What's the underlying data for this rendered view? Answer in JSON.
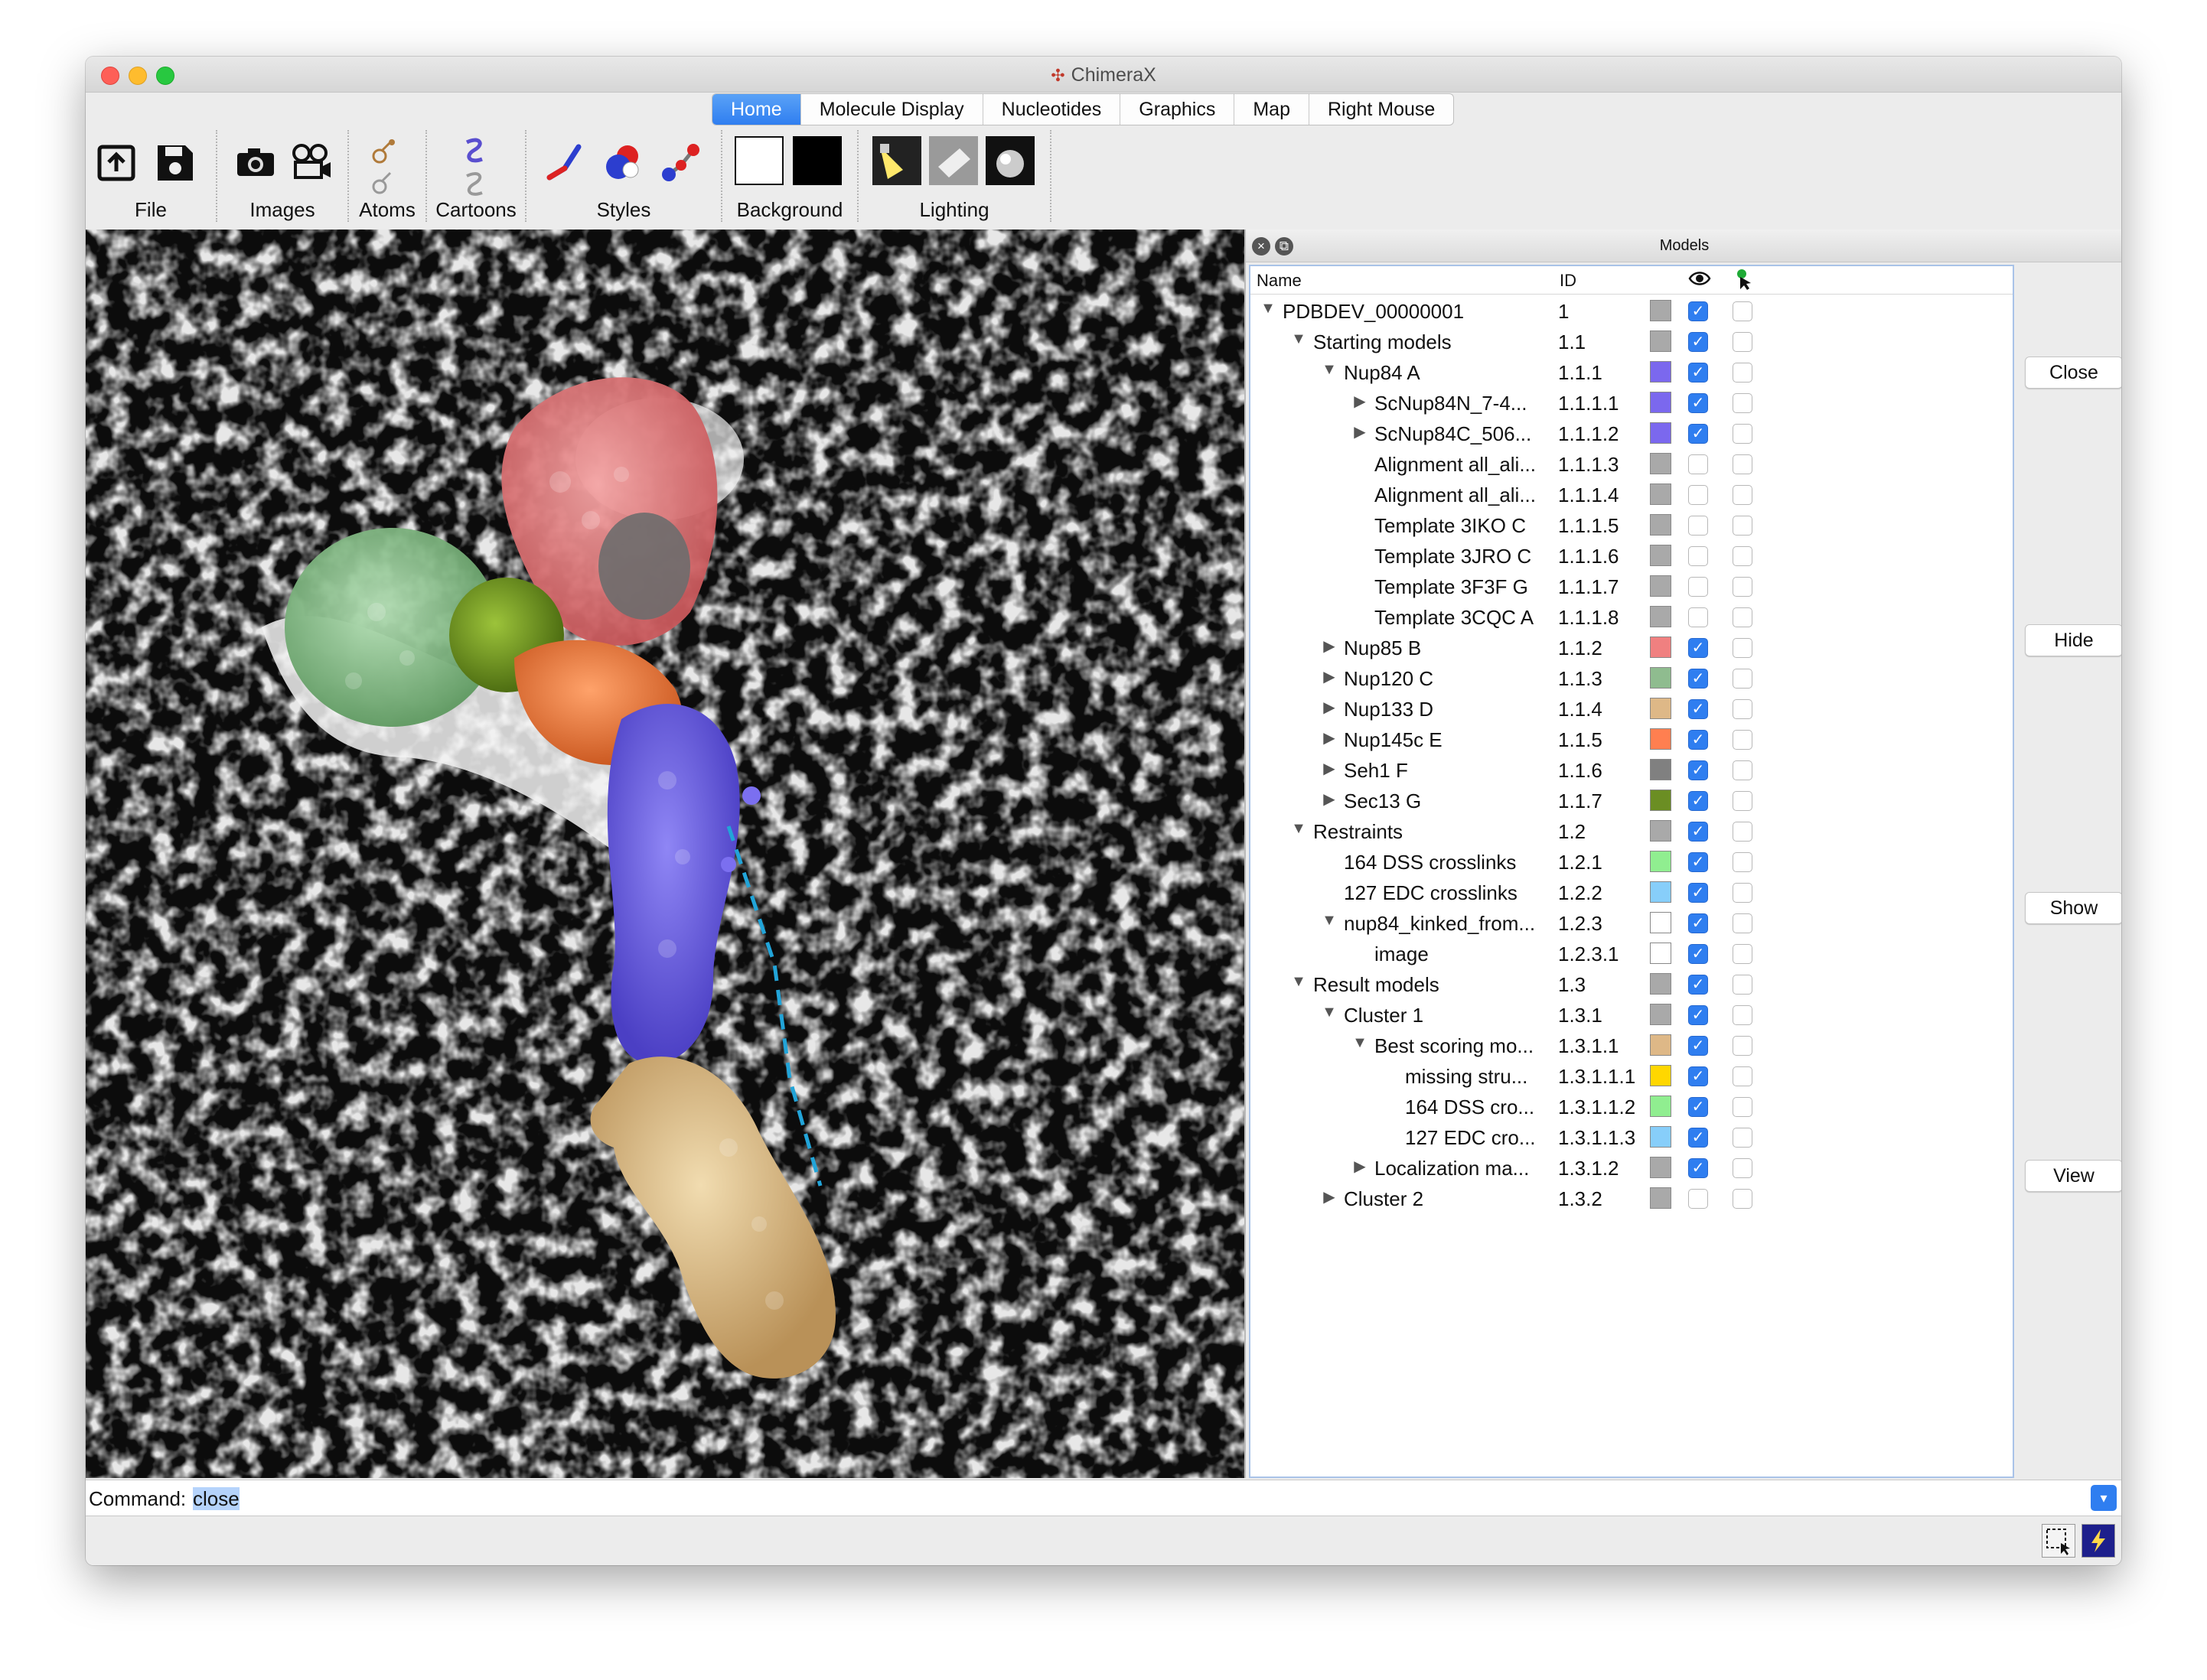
{
  "app": {
    "title": "ChimeraX"
  },
  "tabs": [
    "Home",
    "Molecule Display",
    "Nucleotides",
    "Graphics",
    "Map",
    "Right Mouse"
  ],
  "toolbar": {
    "groups": [
      {
        "label": "File",
        "icons": [
          "open-file-icon",
          "save-file-icon"
        ]
      },
      {
        "label": "Images",
        "icons": [
          "camera-icon",
          "movie-camera-icon"
        ]
      },
      {
        "label": "Atoms",
        "icons": [
          "show-atoms-icon",
          "hide-atoms-icon"
        ]
      },
      {
        "label": "Cartoons",
        "icons": [
          "show-cartoon-icon",
          "hide-cartoon-icon"
        ]
      },
      {
        "label": "Styles",
        "icons": [
          "stick-style-icon",
          "sphere-style-icon",
          "ball-stick-style-icon"
        ]
      },
      {
        "label": "Background",
        "icons": [
          "white-background-icon",
          "black-background-icon"
        ]
      },
      {
        "label": "Lighting",
        "icons": [
          "simple-lighting-icon",
          "soft-lighting-icon",
          "full-lighting-icon"
        ]
      }
    ]
  },
  "models_panel": {
    "title": "Models",
    "columns": {
      "name": "Name",
      "id": "ID"
    },
    "rows": [
      {
        "name": "PDBDEV_00000001",
        "id": "1",
        "level": 0,
        "arrow": "down",
        "color": "#a9a9a9",
        "shown": true
      },
      {
        "name": "Starting models",
        "id": "1.1",
        "level": 1,
        "arrow": "down",
        "color": "#a9a9a9",
        "shown": true
      },
      {
        "name": "Nup84 A",
        "id": "1.1.1",
        "level": 2,
        "arrow": "down",
        "color": "#7b68ee",
        "shown": true
      },
      {
        "name": "ScNup84N_7-4...",
        "id": "1.1.1.1",
        "level": 3,
        "arrow": "right",
        "color": "#7b68ee",
        "shown": true
      },
      {
        "name": "ScNup84C_506...",
        "id": "1.1.1.2",
        "level": 3,
        "arrow": "right",
        "color": "#7b68ee",
        "shown": true
      },
      {
        "name": "Alignment all_ali...",
        "id": "1.1.1.3",
        "level": 3,
        "arrow": "",
        "color": "#a9a9a9",
        "shown": false
      },
      {
        "name": "Alignment all_ali...",
        "id": "1.1.1.4",
        "level": 3,
        "arrow": "",
        "color": "#a9a9a9",
        "shown": false
      },
      {
        "name": "Template 3IKO C",
        "id": "1.1.1.5",
        "level": 3,
        "arrow": "",
        "color": "#a9a9a9",
        "shown": false
      },
      {
        "name": "Template 3JRO C",
        "id": "1.1.1.6",
        "level": 3,
        "arrow": "",
        "color": "#a9a9a9",
        "shown": false
      },
      {
        "name": "Template 3F3F G",
        "id": "1.1.1.7",
        "level": 3,
        "arrow": "",
        "color": "#a9a9a9",
        "shown": false
      },
      {
        "name": "Template 3CQC A",
        "id": "1.1.1.8",
        "level": 3,
        "arrow": "",
        "color": "#a9a9a9",
        "shown": false
      },
      {
        "name": "Nup85 B",
        "id": "1.1.2",
        "level": 2,
        "arrow": "right",
        "color": "#f08080",
        "shown": true
      },
      {
        "name": "Nup120 C",
        "id": "1.1.3",
        "level": 2,
        "arrow": "right",
        "color": "#8fbc8f",
        "shown": true
      },
      {
        "name": "Nup133 D",
        "id": "1.1.4",
        "level": 2,
        "arrow": "right",
        "color": "#deb887",
        "shown": true
      },
      {
        "name": "Nup145c E",
        "id": "1.1.5",
        "level": 2,
        "arrow": "right",
        "color": "#ff7f50",
        "shown": true
      },
      {
        "name": "Seh1 F",
        "id": "1.1.6",
        "level": 2,
        "arrow": "right",
        "color": "#808080",
        "shown": true
      },
      {
        "name": "Sec13 G",
        "id": "1.1.7",
        "level": 2,
        "arrow": "right",
        "color": "#6b8e23",
        "shown": true
      },
      {
        "name": "Restraints",
        "id": "1.2",
        "level": 1,
        "arrow": "down",
        "color": "#a9a9a9",
        "shown": true
      },
      {
        "name": "164 DSS crosslinks",
        "id": "1.2.1",
        "level": 2,
        "arrow": "",
        "color": "#90ee90",
        "shown": true
      },
      {
        "name": "127 EDC crosslinks",
        "id": "1.2.2",
        "level": 2,
        "arrow": "",
        "color": "#87cefa",
        "shown": true
      },
      {
        "name": "nup84_kinked_from...",
        "id": "1.2.3",
        "level": 2,
        "arrow": "down",
        "color": "#ffffff",
        "shown": true
      },
      {
        "name": "image",
        "id": "1.2.3.1",
        "level": 3,
        "arrow": "",
        "color": "#ffffff",
        "shown": true
      },
      {
        "name": "Result models",
        "id": "1.3",
        "level": 1,
        "arrow": "down",
        "color": "#a9a9a9",
        "shown": true
      },
      {
        "name": "Cluster 1",
        "id": "1.3.1",
        "level": 2,
        "arrow": "down",
        "color": "#a9a9a9",
        "shown": true
      },
      {
        "name": "Best scoring mo...",
        "id": "1.3.1.1",
        "level": 3,
        "arrow": "down",
        "color": "#deb887",
        "shown": true
      },
      {
        "name": "missing stru...",
        "id": "1.3.1.1.1",
        "level": 4,
        "arrow": "",
        "color": "#ffd700",
        "shown": true
      },
      {
        "name": "164 DSS cro...",
        "id": "1.3.1.1.2",
        "level": 4,
        "arrow": "",
        "color": "#90ee90",
        "shown": true
      },
      {
        "name": "127 EDC cro...",
        "id": "1.3.1.1.3",
        "level": 4,
        "arrow": "",
        "color": "#87cefa",
        "shown": true
      },
      {
        "name": "Localization ma...",
        "id": "1.3.1.2",
        "level": 3,
        "arrow": "right",
        "color": "#a9a9a9",
        "shown": true
      },
      {
        "name": "Cluster 2",
        "id": "1.3.2",
        "level": 2,
        "arrow": "right",
        "color": "#a9a9a9",
        "shown": false
      }
    ],
    "buttons": {
      "close": "Close",
      "hide": "Hide",
      "show": "Show",
      "view": "View"
    }
  },
  "command": {
    "label": "Command:",
    "value": "close"
  }
}
